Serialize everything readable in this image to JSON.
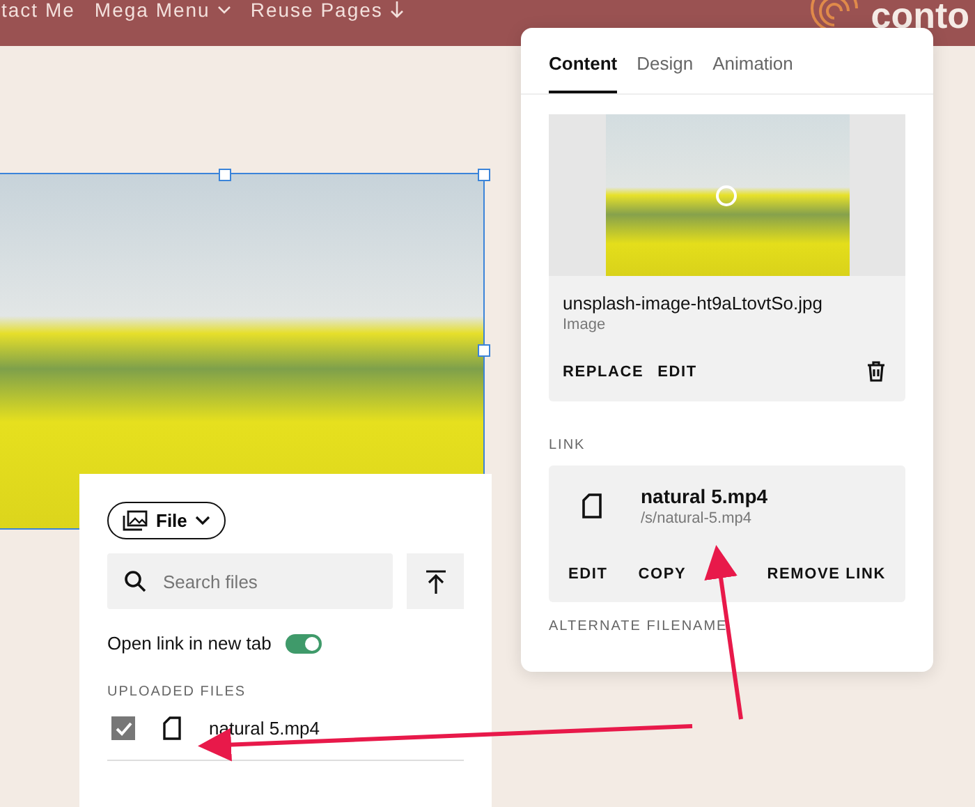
{
  "nav": {
    "items": [
      {
        "label": "tact Me",
        "kind": "plain"
      },
      {
        "label": "Mega Menu",
        "kind": "dropdown"
      },
      {
        "label": "Reuse Pages",
        "kind": "download"
      }
    ],
    "logo_text": "conto"
  },
  "editor_panel": {
    "tabs": [
      {
        "label": "Content",
        "selected": true
      },
      {
        "label": "Design",
        "selected": false
      },
      {
        "label": "Animation",
        "selected": false
      }
    ],
    "image_card": {
      "filename": "unsplash-image-ht9aLtovtSo.jpg",
      "type": "Image",
      "actions": [
        "REPLACE",
        "EDIT"
      ]
    },
    "link_label": "LINK",
    "link_card": {
      "name": "natural 5.mp4",
      "path": "/s/natural-5.mp4",
      "actions": [
        "EDIT",
        "COPY"
      ],
      "remove": "REMOVE LINK"
    },
    "next_label": "ALTERNATE FILENAME"
  },
  "file_panel": {
    "type_button": "File",
    "search": {
      "placeholder": "Search files"
    },
    "new_tab": {
      "label": "Open link in new tab",
      "on": true
    },
    "section_label": "UPLOADED FILES",
    "files": [
      {
        "name": "natural 5.mp4",
        "checked": true
      }
    ]
  }
}
